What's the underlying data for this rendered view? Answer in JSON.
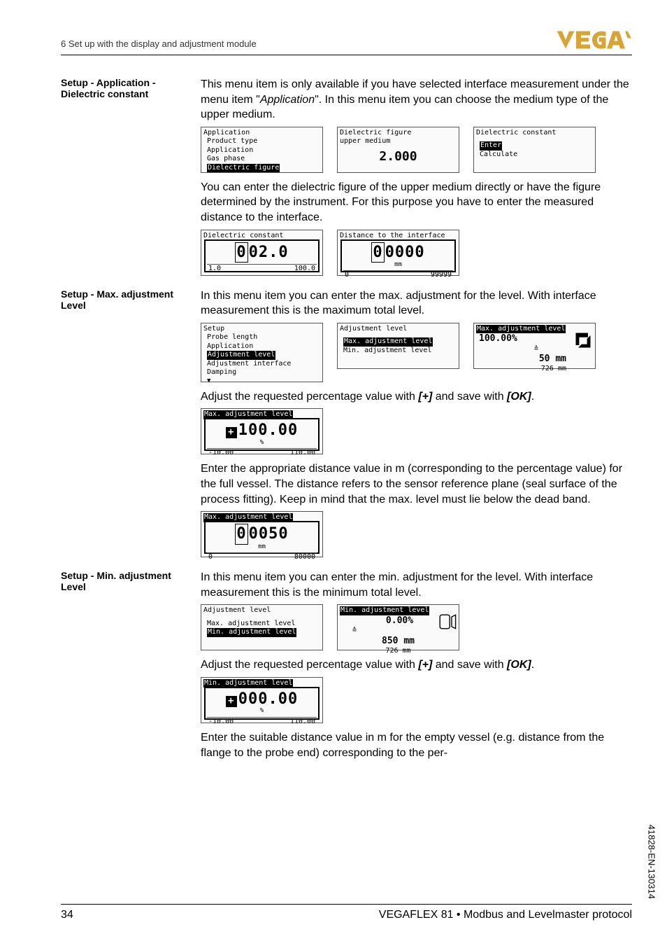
{
  "header": {
    "section": "6 Set up with the display and adjustment module"
  },
  "sec1": {
    "title": "Setup - Application - Dielectric constant",
    "p1_a": "This menu item is only available if you have selected interface measurement under the menu item \"",
    "p1_i": "Application",
    "p1_b": "\". In this menu item you can choose the medium type of the upper medium.",
    "lcd_app": {
      "title": "Application",
      "i1": "Product type",
      "i2": "Application",
      "i3": "Gas phase",
      "i4": "Dielectric figure"
    },
    "lcd_df": {
      "title": "Dielectric figure",
      "sub": "upper medium",
      "val": "2.000"
    },
    "lcd_dc": {
      "title": "Dielectric constant",
      "i1": "Enter",
      "i2": "Calculate"
    },
    "p2": "You can enter the dielectric figure of the upper medium directly or have the figure determined by the instrument. For this purpose you have to enter the measured distance to the interface.",
    "lcd_dc2": {
      "title": "Dielectric constant",
      "val": "02.0",
      "lo": "1.0",
      "hi": "100.0"
    },
    "lcd_dist": {
      "title": "Distance to the interface",
      "val": "0000",
      "unit": "mm",
      "lo": "0",
      "hi": "99999"
    }
  },
  "sec2": {
    "title": "Setup - Max. adjustment Level",
    "p1": "In this menu item you can enter the max. adjustment for the level. With interface measurement this is the maximum total level.",
    "lcd_setup": {
      "title": "Setup",
      "i1": "Probe length",
      "i2": "Application",
      "i3": "Adjustment level",
      "i4": "Adjustment interface",
      "i5": "Damping"
    },
    "lcd_adj": {
      "title": "Adjustment level",
      "i1": "Max. adjustment level",
      "i2": "Min. adjustment level"
    },
    "lcd_max": {
      "title": "Max. adjustment level",
      "pct": "100.00%",
      "d1": "50 mm",
      "d2": "726 mm"
    },
    "p2_a": "Adjust the requested percentage value with ",
    "p2_b1": "[+]",
    "p2_mid": " and save with ",
    "p2_b2": "[OK]",
    "p2_end": ".",
    "lcd_max2": {
      "title": "Max. adjustment level",
      "val": "100.00",
      "unit": "%",
      "lo": "-10.00",
      "hi": "110.00"
    },
    "p3": "Enter the appropriate distance value in m (corresponding to the percentage value) for the full vessel. The distance refers to the sensor reference plane (seal surface of the process fitting). Keep in mind that the max. level must lie below the dead band.",
    "lcd_max3": {
      "title": "Max. adjustment level",
      "val": "0050",
      "unit": "mm",
      "lo": "0",
      "hi": "80000"
    }
  },
  "sec3": {
    "title": "Setup - Min. adjustment Level",
    "p1": "In this menu item you can enter the min. adjustment for the level. With interface measurement this is the minimum total level.",
    "lcd_adj": {
      "title": "Adjustment level",
      "i1": "Max. adjustment level",
      "i2": "Min. adjustment level"
    },
    "lcd_min": {
      "title": "Min. adjustment level",
      "pct": "0.00%",
      "d1": "850 mm",
      "d2": "726 mm"
    },
    "p2_a": "Adjust the requested percentage value with ",
    "p2_b1": "[+]",
    "p2_mid": " and save with ",
    "p2_b2": "[OK]",
    "p2_end": ".",
    "lcd_min2": {
      "title": "Min. adjustment level",
      "val": "000.00",
      "unit": "%",
      "lo": "-10.00",
      "hi": "110.00"
    },
    "p3": "Enter the suitable distance value in m for the empty vessel (e.g. distance from the flange to the probe end) corresponding to the per-"
  },
  "footer": {
    "page": "34",
    "product": "VEGAFLEX 81 • Modbus and Levelmaster protocol",
    "docid": "41828-EN-130314"
  }
}
